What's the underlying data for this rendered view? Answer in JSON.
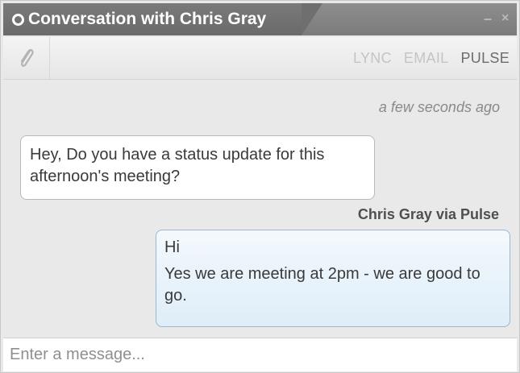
{
  "window": {
    "title": "Conversation with Chris Gray",
    "minimize_glyph": "–",
    "close_glyph": "×"
  },
  "toolbar": {
    "attach_icon": "paperclip-icon",
    "channels": [
      {
        "label": "LYNC",
        "active": false
      },
      {
        "label": "EMAIL",
        "active": false
      },
      {
        "label": "PULSE",
        "active": true
      }
    ]
  },
  "conversation": {
    "timestamp": "a few seconds ago",
    "incoming_message": "Hey, Do you have a status update for this afternoon's meeting?",
    "sender_label": "Chris Gray via Pulse",
    "outgoing_messages": [
      "Hi",
      "Yes we are meeting at 2pm - we are good to go."
    ]
  },
  "composer": {
    "placeholder": "Enter a message...",
    "value": ""
  },
  "colors": {
    "titlebar": "#7b7b7b",
    "active_channel": "#6c6c6c",
    "inactive_channel": "#c4c4c4",
    "outgoing_bubble": "#deedf8"
  }
}
